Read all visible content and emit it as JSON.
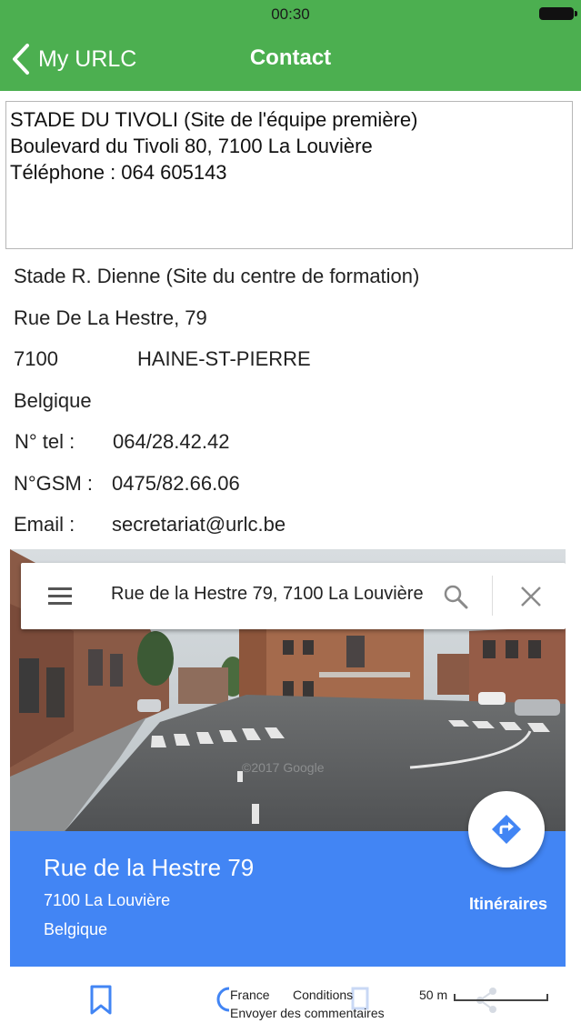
{
  "status_bar": {
    "time": "00:30"
  },
  "nav": {
    "back_label": "My URLC",
    "title": "Contact"
  },
  "address_box": {
    "lines": [
      "STADE DU TIVOLI (Site de l'équipe première)",
      "Boulevard du Tivoli 80, 7100 La Louvière",
      "Téléphone : 064 605143"
    ]
  },
  "info": {
    "venue": "Stade R. Dienne  (Site du centre de formation)",
    "street": "Rue De La Hestre, 79",
    "postcode": "7100",
    "city": "HAINE-ST-PIERRE",
    "country": "Belgique",
    "tel_label": "N° tel  :",
    "tel_value": "064/28.42.42",
    "gsm_label": "N°GSM :",
    "gsm_value": "0475/82.66.06",
    "email_label": "Email :",
    "email_value": "secretariat@urlc.be"
  },
  "map": {
    "search_text": "Rue de la Hestre 79, 7100 La Louvière",
    "watermark": "©2017 Google",
    "place_title": "Rue de la Hestre 79",
    "place_line1": "7100 La Louvière",
    "place_line2": "Belgique",
    "directions_label": "Itinéraires",
    "accent_color": "#4285f4"
  },
  "map_footer": {
    "country": "France",
    "terms": "Conditions",
    "feedback": "Envoyer des commentaires",
    "scale": "50 m"
  },
  "colors": {
    "header_green": "#4caf50"
  },
  "icons": [
    "back-chevron-icon",
    "hamburger-menu-icon",
    "search-icon",
    "close-icon",
    "directions-icon",
    "bookmark-icon",
    "share-icon",
    "battery-icon"
  ]
}
